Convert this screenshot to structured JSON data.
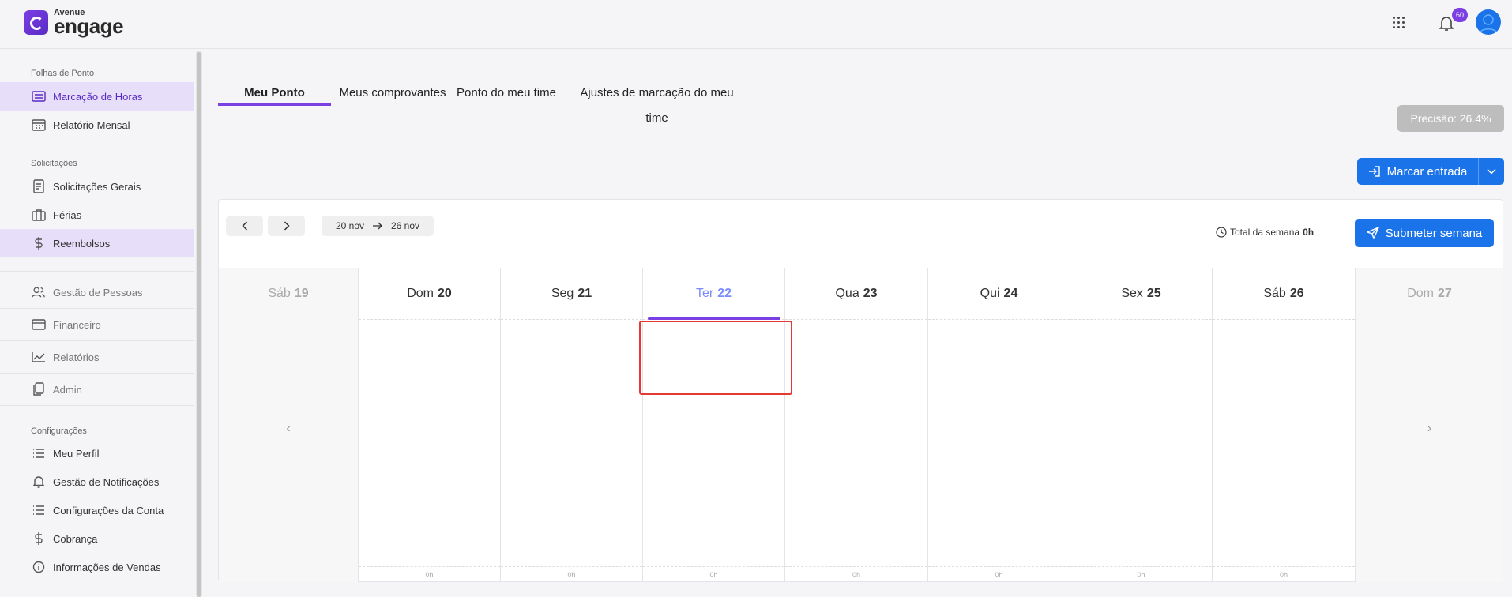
{
  "brand": {
    "small": "Avenue",
    "big": "engage"
  },
  "header": {
    "notification_count": "60"
  },
  "sidebar": {
    "section1_title": "Folhas de Ponto",
    "item_marcacao": "Marcação de Horas",
    "item_relatorio_mensal": "Relatório Mensal",
    "section2_title": "Solicitações",
    "item_solicitacoes": "Solicitações Gerais",
    "item_ferias": "Férias",
    "item_reembolsos": "Reembolsos",
    "item_gestao_pessoas": "Gestão de Pessoas",
    "item_financeiro": "Financeiro",
    "item_relatorios": "Relatórios",
    "item_admin": "Admin",
    "section3_title": "Configurações",
    "item_meu_perfil": "Meu Perfil",
    "item_notificacoes": "Gestão de Notificações",
    "item_config_conta": "Configurações da Conta",
    "item_cobranca": "Cobrança",
    "item_info_vendas": "Informações de Vendas"
  },
  "tabs": {
    "meu_ponto": "Meu Ponto",
    "comprovantes": "Meus comprovantes",
    "ponto_time": "Ponto do meu time",
    "ajustes": "Ajustes de marcação do meu time"
  },
  "precision": "Precisão: 26.4%",
  "actions": {
    "marcar_entrada": "Marcar entrada",
    "submeter_semana": "Submeter semana"
  },
  "week": {
    "start": "20 nov",
    "end": "26 nov",
    "total_label": "Total da semana",
    "total_value": "0h"
  },
  "days": [
    {
      "wd": "Sáb",
      "num": "19"
    },
    {
      "wd": "Dom",
      "num": "20",
      "total": "0h"
    },
    {
      "wd": "Seg",
      "num": "21",
      "total": "0h"
    },
    {
      "wd": "Ter",
      "num": "22",
      "total": "0h"
    },
    {
      "wd": "Qua",
      "num": "23",
      "total": "0h"
    },
    {
      "wd": "Qui",
      "num": "24",
      "total": "0h"
    },
    {
      "wd": "Sex",
      "num": "25",
      "total": "0h"
    },
    {
      "wd": "Sáb",
      "num": "26",
      "total": "0h"
    },
    {
      "wd": "Dom",
      "num": "27"
    }
  ],
  "colors": {
    "accent": "#7b3fe4",
    "primary": "#1a73e8",
    "active_bg": "#e7def9",
    "selection": "#e53935"
  }
}
